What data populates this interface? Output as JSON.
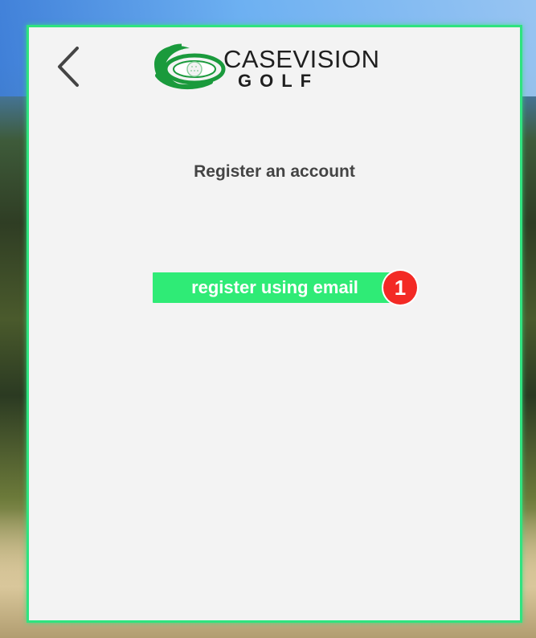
{
  "logo": {
    "text_line1": "CASEVISION",
    "text_line2": "GOLF"
  },
  "main": {
    "title": "Register an account",
    "register_email_label": "register using email",
    "badge_number": "1"
  },
  "icons": {
    "back": "chevron-left-icon",
    "logo": "casevision-golf-logo"
  },
  "colors": {
    "panel_border": "#2fe37f",
    "button": "#2feb76",
    "badge": "#f32a25",
    "logo_green": "#1a9a3c"
  }
}
